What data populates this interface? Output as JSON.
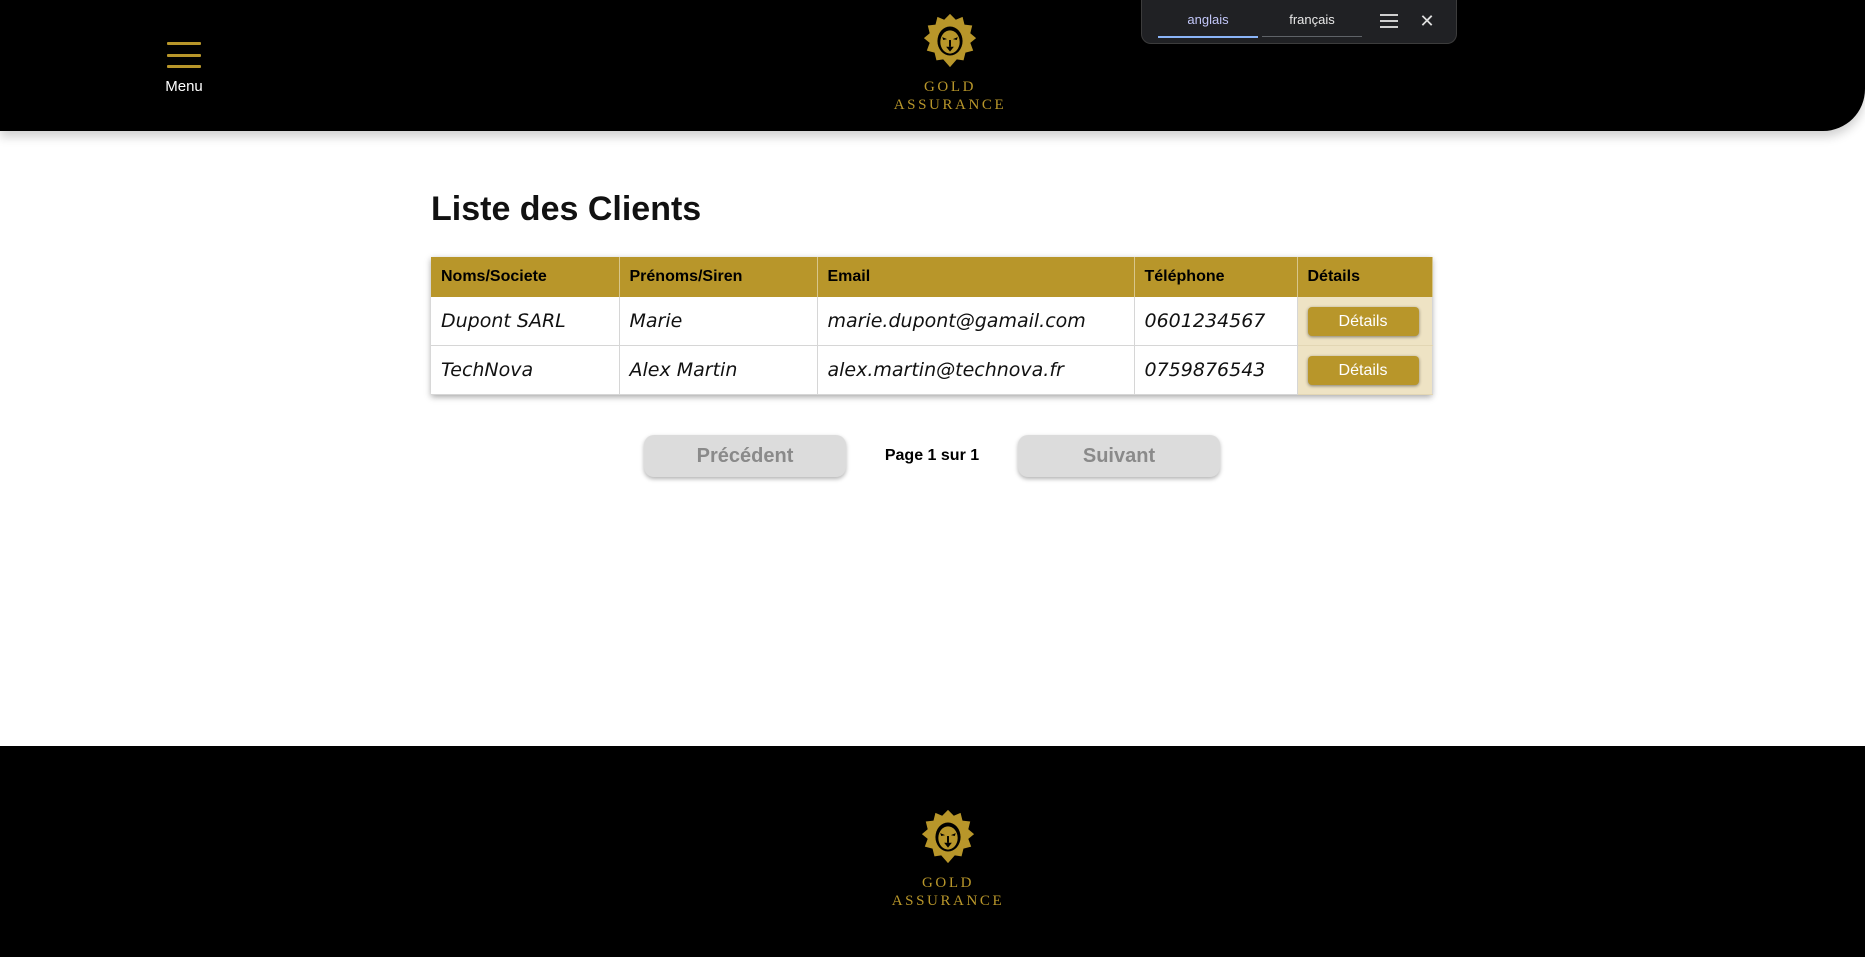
{
  "header": {
    "menu_label": "Menu",
    "logo": {
      "line1": "GOLD",
      "line2": "ASSURANCE",
      "icon": "lion-head-icon"
    }
  },
  "translate": {
    "tabs": [
      {
        "label": "anglais",
        "active": true
      },
      {
        "label": "français",
        "active": false
      }
    ],
    "menu_icon": "hamburger-icon",
    "close_icon": "close-icon",
    "close_glyph": "✕"
  },
  "main": {
    "title": "Liste des Clients",
    "table": {
      "headers": [
        "Noms/Societe",
        "Prénoms/Siren",
        "Email",
        "Téléphone",
        "Détails"
      ],
      "rows": [
        [
          "Dupont SARL",
          "Marie",
          "marie.dupont@gamail.com",
          "0601234567",
          "Détails"
        ],
        [
          "TechNova",
          "Alex Martin",
          "alex.martin@technova.fr",
          "0759876543",
          "Détails"
        ]
      ]
    },
    "pagination": {
      "prev_label": "Précédent",
      "info": "Page 1 sur 1",
      "next_label": "Suivant"
    }
  },
  "footer": {
    "logo": {
      "line1": "GOLD",
      "line2": "ASSURANCE",
      "icon": "lion-head-icon"
    }
  },
  "colors": {
    "gold": "#b8962a",
    "black": "#000000",
    "details_cell_bg": "#eee3c4",
    "disabled_button": "#dcdcdc"
  }
}
